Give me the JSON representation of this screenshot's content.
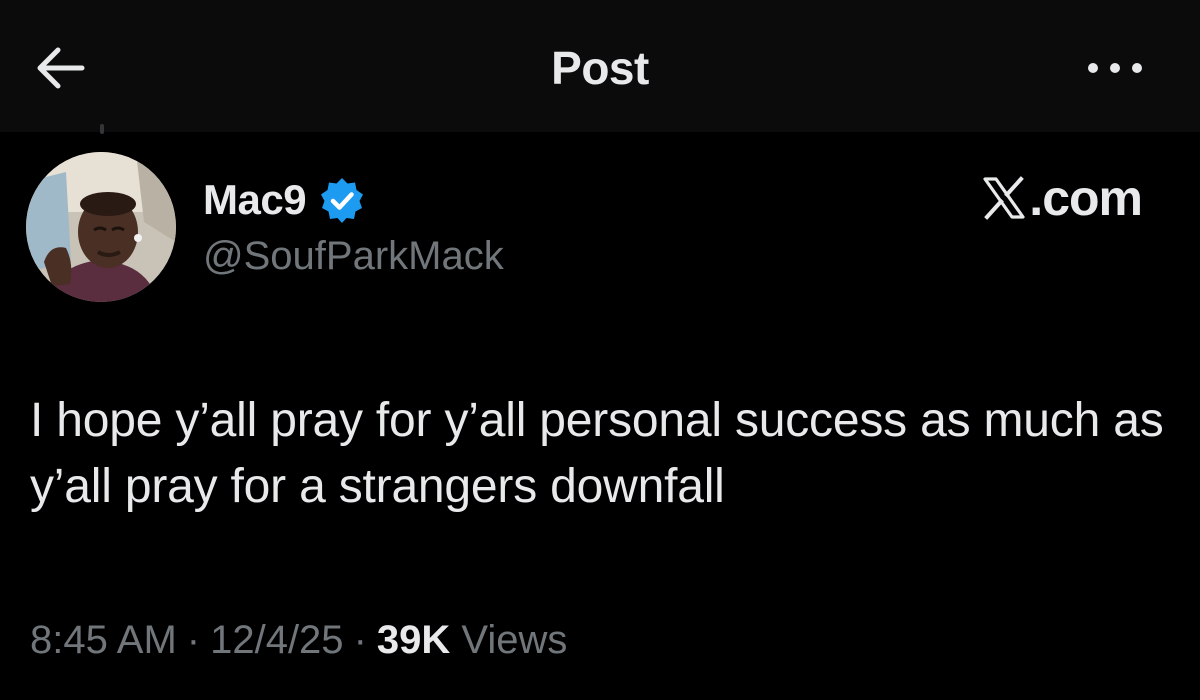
{
  "header": {
    "back_icon": "arrow-left-icon",
    "title": "Post",
    "more_icon": "more-horizontal-icon"
  },
  "author": {
    "display_name": "Mac9",
    "verified_icon": "verified-badge-icon",
    "verified_color": "#1d9bf0",
    "handle": "@SoufParkMack"
  },
  "watermark": {
    "logo_icon": "x-logo-icon",
    "text": ".com"
  },
  "post": {
    "text": "I hope y’all pray for y’all personal success as much as y’all pray for a strangers downfall"
  },
  "meta": {
    "time": "8:45 AM",
    "separator": "·",
    "date": "12/4/25",
    "views_count": "39K",
    "views_label": "Views"
  },
  "colors": {
    "background": "#000000",
    "header_background": "#0b0b0b",
    "primary_text": "#e7e9ea",
    "secondary_text": "#71767b",
    "accent": "#1d9bf0"
  }
}
